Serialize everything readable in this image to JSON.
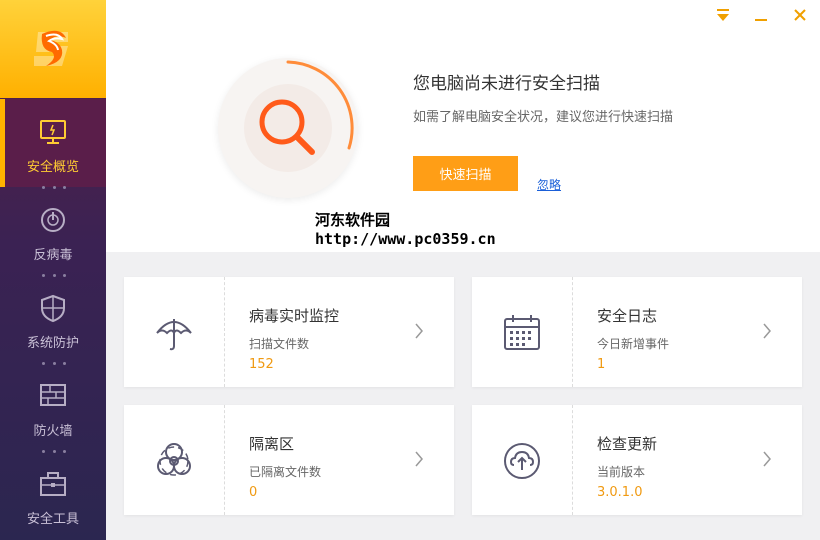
{
  "app": {
    "accent": "#ff9e16",
    "sidebar_active_color": "#ffcc33"
  },
  "window": {
    "menu_icon": "dropdown-triangle-icon",
    "minimize_icon": "minimize-icon",
    "close_icon": "close-icon"
  },
  "sidebar": {
    "items": [
      {
        "label": "安全概览",
        "icon": "monitor-icon",
        "active": true
      },
      {
        "label": "反病毒",
        "icon": "gauge-icon",
        "active": false
      },
      {
        "label": "系统防护",
        "icon": "shield-icon",
        "active": false
      },
      {
        "label": "防火墙",
        "icon": "firewall-icon",
        "active": false
      },
      {
        "label": "安全工具",
        "icon": "toolbox-icon",
        "active": false
      }
    ]
  },
  "status": {
    "title": "您电脑尚未进行安全扫描",
    "description": "如需了解电脑安全状况，建议您进行快速扫描",
    "scan_button": "快速扫描",
    "ignore_link": "忽略"
  },
  "watermark": {
    "name": "河东软件园",
    "url": "http://www.pc0359.cn"
  },
  "cards": [
    {
      "title": "病毒实时监控",
      "subtitle": "扫描文件数",
      "value": "152",
      "icon": "umbrella-icon"
    },
    {
      "title": "安全日志",
      "subtitle": "今日新增事件",
      "value": "1",
      "icon": "calendar-icon"
    },
    {
      "title": "隔离区",
      "subtitle": "已隔离文件数",
      "value": "0",
      "icon": "biohazard-icon"
    },
    {
      "title": "检查更新",
      "subtitle": "当前版本",
      "value": "3.0.1.0",
      "icon": "upload-cloud-icon"
    }
  ]
}
